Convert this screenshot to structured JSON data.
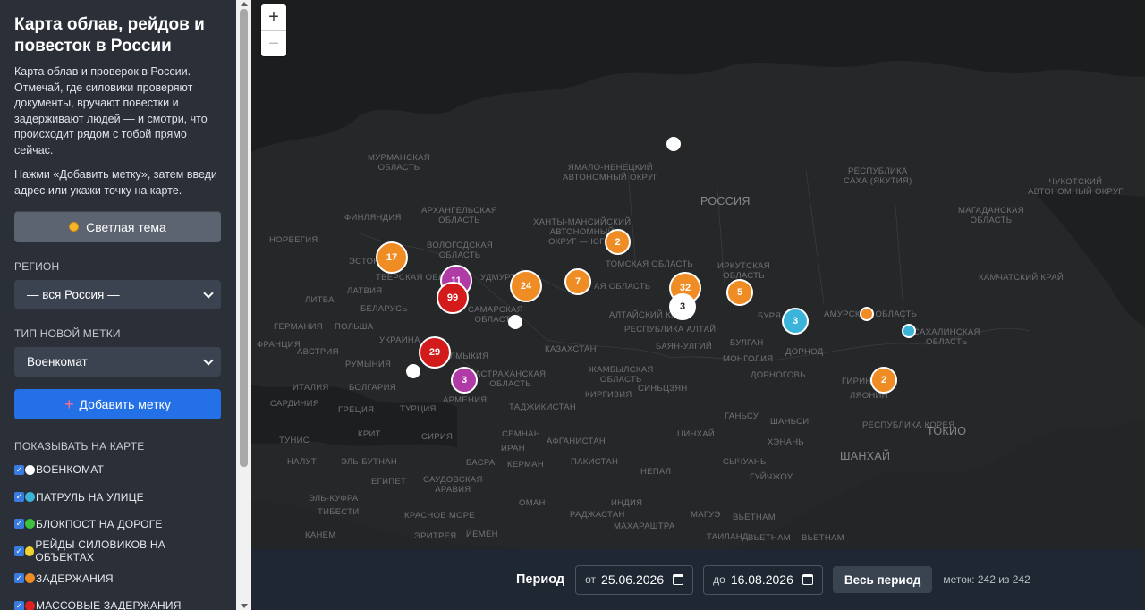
{
  "sidebar": {
    "title": "Карта облав, рейдов и повесток в России",
    "description": "Карта облав и проверок в России. Отмечай, где силовики проверяют документы, вручают повестки и задерживают людей — и смотри, что происходит рядом с тобой прямо сейчас.",
    "hint": "Нажми «Добавить метку», затем введи адрес или укажи точку на карте.",
    "theme_button": "Светлая тема",
    "region_label": "РЕГИОН",
    "region_value": "— вся Россия —",
    "type_label": "ТИП НОВОЙ МЕТКИ",
    "type_value": "Военкомат",
    "add_button": "Добавить метку",
    "filters_label": "ПОКАЗЫВАТЬ НА КАРТЕ",
    "filters": [
      {
        "label": "ВОЕНКОМАТ",
        "color": "#ffffff"
      },
      {
        "label": "ПАТРУЛЬ НА УЛИЦЕ",
        "color": "#3bb4d9"
      },
      {
        "label": "БЛОКПОСТ НА ДОРОГЕ",
        "color": "#3cc23c"
      },
      {
        "label": "РЕЙДЫ СИЛОВИКОВ НА ОБЪЕКТАХ",
        "color": "#f2d22e"
      },
      {
        "label": "ЗАДЕРЖАНИЯ",
        "color": "#f08c24"
      },
      {
        "label": "МАССОВЫЕ ЗАДЕРЖАНИЯ",
        "color": "#e02020"
      }
    ]
  },
  "map": {
    "zoom_in": "+",
    "zoom_out": "−",
    "places": {
      "murmansk": "МУРМАНСКАЯ\nОБЛАСТЬ",
      "yamal": "ЯМАЛО-НЕНЕЦКИЙ\nАВТОНОМНЫЙ ОКРУГ",
      "russia": "РОССИЯ",
      "yakutia": "РЕСПУБЛИКА\nСАХА (ЯКУТИЯ)",
      "chukotka": "ЧУКОТСКИЙ\nАВТОНОМНЫЙ ОКРУГ",
      "magadan": "МАГАДАНСКАЯ\nОБЛАСТЬ",
      "finland": "ФИНЛЯНДИЯ",
      "arkhangelsk": "АРХАНГЕЛЬСКАЯ\nОБЛАСТЬ",
      "norway": "НОРВЕГИЯ",
      "khanty": "ХАНТЫ-МАНСИЙСКИЙ\nАВТОНОМНЫЙ\nОКРУГ — ЮГРА",
      "vologda": "ВОЛОГОДСКАЯ\nОБЛАСТЬ",
      "estonia": "ЭСТОН",
      "tver": "ТВЕРСКАЯ ОБЛ",
      "tomsk": "ТОМСКАЯ ОБЛАСТЬ",
      "irkutsk": "ИРКУТСКАЯ\nОБЛАСТЬ",
      "kamchatka": "КАМЧАТСКИЙ КРАЙ",
      "udmurt": "УДМУРТ",
      "latvia": "ЛАТВИЯ",
      "lithuania": "ЛИТВА",
      "belarus": "БЕЛАРУСЬ",
      "samara": "САМАРСКАЯ\nОБЛАСТЬ",
      "novosib": "АЯ ОБЛАСТЬ",
      "altai_krai": "АЛТАЙСКИЙ КРАЙ",
      "altai_rep": "РЕСПУБЛИКА АЛТАЙ",
      "buryat": "БУРЯ",
      "amur": "АМУРСКАЯ ОБЛАСТЬ",
      "sakhalin": "САХАЛИНСКАЯ\nОБЛАСТЬ",
      "germany": "ГЕРМАНИЯ",
      "poland": "ПОЛЬША",
      "ukraine": "УКРАИНА",
      "kazakhstan": "КАЗАХСТАН",
      "bayan": "БАЯН-УЛГИЙ",
      "bulgan": "БУЛГАН",
      "mongolia": "МОНГОЛИЯ",
      "dornod": "ДОРНОД",
      "france": "ФРАНЦИЯ",
      "austria": "АВСТРИЯ",
      "romania": "РУМЫНИЯ",
      "kalmykia": "КАЛМЫКИЯ",
      "astrakhan": "АСТРАХАНСКАЯ\nОБЛАСТЬ",
      "zhambyl": "ЖАМБЫЛСКАЯ\nОБЛАСТЬ",
      "kyrgyzstan": "КИРГИЗИЯ",
      "xinjiang": "СИНЬЦЗЯН",
      "dornogovi": "ДОРНОГОВЬ",
      "jilin": "ГИРИН",
      "liaoning": "ЛЯОНИН",
      "italy": "ИТАЛИЯ",
      "bulgaria": "БОЛГАРИЯ",
      "armenia": "АРМЕНИЯ",
      "sardinia": "САРДИНИЯ",
      "greece": "ГРЕЦИЯ",
      "turkey": "ТУРЦИЯ",
      "tajikistan": "ТАДЖИКИСТАН",
      "gansu": "ГАНЬСУ",
      "shanxi": "ШАНЬСИ",
      "nkorea": "КНДР",
      "skorea": "РЕСПУБЛИКА КОРЕЯ",
      "tokyo": "ТОКИО",
      "tunis": "ТУНИС",
      "crete": "КРИТ",
      "syria": "СИРИЯ",
      "semnan": "СЕМНАН",
      "afghanistan": "АФГАНИСТАН",
      "qinghai": "ЦИНХАЙ",
      "henan": "ХЭНАНЬ",
      "shanghai": "ШАНХАЙ",
      "nalut": "НАЛУТ",
      "elbutnan": "ЭЛЬ-БУТНАН",
      "iran": "ИРАН",
      "pakistan": "ПАКИСТАН",
      "nepal": "НЕПАЛ",
      "sichuan": "СЫЧУАНЬ",
      "basra": "БАСРА",
      "elkufra": "ЭЛЬ-КУФРА",
      "egypt": "ЕГИПЕТ",
      "saudi": "САУДОВСКАЯ\nАРАВИЯ",
      "kerman": "КЕРМАН",
      "india": "ИНДИЯ",
      "guizhou": "ГУЙЧЖОУ",
      "tibesti": "ТИБЕСТИ",
      "redsea": "КРАСНОЕ МОРЕ",
      "oman": "ОМАН",
      "rajasthan": "РАДЖАСТАН",
      "maharashtra": "МАХАРАШТРА",
      "magway": "МАГУЭ",
      "vietnam_n": "ВЬЕТНАМ",
      "kanem": "КАНЕМ",
      "eritrea": "ЭРИТРЕЯ",
      "yemen": "ЙЕМЕН",
      "thailand": "ТАИЛАНД",
      "vietnam": "ВЬЕТНАМ",
      "philippines": "ВЬЕТНАМ"
    },
    "markers": [
      {
        "value": "17",
        "color": "#f08c24"
      },
      {
        "value": "11",
        "color": "#b03aa6"
      },
      {
        "value": "99",
        "color": "#d41b1b"
      },
      {
        "value": "24",
        "color": "#f08c24"
      },
      {
        "value": "7",
        "color": "#f08c24"
      },
      {
        "value": "2",
        "color": "#f08c24"
      },
      {
        "value": "32",
        "color": "#f08c24"
      },
      {
        "value": "3",
        "color": "#ffffff"
      },
      {
        "value": "5",
        "color": "#f08c24"
      },
      {
        "value": "3",
        "color": "#3bb4d9"
      },
      {
        "value": "29",
        "color": "#d41b1b"
      },
      {
        "value": "3",
        "color": "#b03aa6"
      },
      {
        "value": "2",
        "color": "#f08c24"
      }
    ]
  },
  "period": {
    "label": "Период",
    "from_prefix": "от",
    "from_value": "25.06.2026",
    "to_prefix": "до",
    "to_value": "16.08.2026",
    "all_button": "Весь период",
    "count": "меток: 242 из 242"
  }
}
